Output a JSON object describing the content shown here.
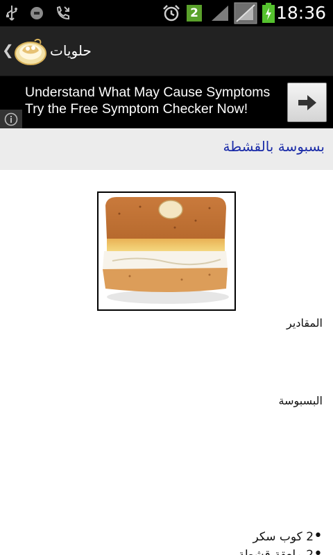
{
  "status_bar": {
    "time": "18:36",
    "notification_count": "2",
    "icons": [
      "usb-icon",
      "record-icon",
      "missed-call-icon",
      "alarm-clock-icon",
      "notification-badge-icon",
      "signal-icon",
      "no-sim-icon",
      "battery-charging-icon"
    ],
    "colors": {
      "badge": "#5aa12b",
      "battery": "#55c22e"
    }
  },
  "action_bar": {
    "title": "حلويات",
    "logo_icon": "dessert-plate-icon",
    "up_icon": "chevron-left-icon"
  },
  "ad": {
    "line1": "Understand What May Cause Symptoms",
    "line2": "Try the Free Symptom Checker Now!",
    "arrow_icon": "arrow-right-icon",
    "info_icon": "info-icon"
  },
  "recipe": {
    "title": "بسبوسة بالقشطة",
    "title_color": "#1a2ba8",
    "image_icon": "basbousa-cake-image",
    "sections": {
      "ingredients_heading": "المقادير",
      "basbousa_heading": "البسبوسة"
    },
    "ingredients": [
      {
        "bullet": "•",
        "qty": "2",
        "text": "كوب سكر"
      },
      {
        "bullet": "•",
        "qty": "2",
        "text": "ملعقة قشطة"
      }
    ]
  }
}
